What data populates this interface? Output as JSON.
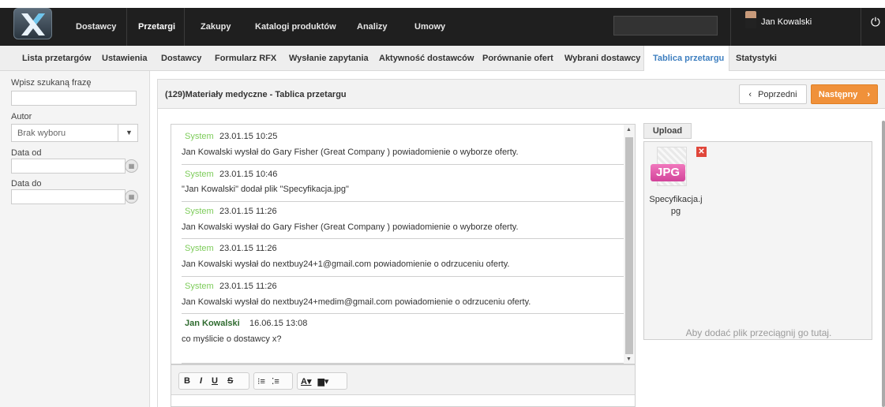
{
  "top_nav": {
    "items": [
      {
        "label": "Dostawcy"
      },
      {
        "label": "Przetargi"
      },
      {
        "label": "Zakupy"
      },
      {
        "label": "Katalogi produktów"
      },
      {
        "label": "Analizy"
      },
      {
        "label": "Umowy"
      }
    ],
    "active": "Przetargi",
    "user_name": "Jan Kowalski",
    "power_icon": "power-icon"
  },
  "sub_nav": {
    "items": [
      {
        "label": "Lista przetargów"
      },
      {
        "label": "Ustawienia"
      },
      {
        "label": "Dostawcy"
      },
      {
        "label": "Formularz RFX"
      },
      {
        "label": "Wysłanie zapytania"
      },
      {
        "label": "Aktywność dostawców"
      },
      {
        "label": "Porównanie ofert"
      },
      {
        "label": "Wybrani dostawcy"
      },
      {
        "label": "Tablica przetargu"
      },
      {
        "label": "Statystyki"
      }
    ],
    "active": "Tablica przetargu"
  },
  "filters": {
    "search_label": "Wpisz szukaną frazę",
    "search_value": "",
    "author_label": "Autor",
    "author_value": "Brak wyboru",
    "date_from_label": "Data od",
    "date_from_value": "",
    "date_to_label": "Data do",
    "date_to_value": ""
  },
  "header": {
    "title": "(129)Materiały medyczne - Tablica przetargu",
    "prev_label": "Poprzedni",
    "next_label": "Następny"
  },
  "messages": [
    {
      "author": "System",
      "type": "system",
      "time": "23.01.15 10:25",
      "text": "Jan Kowalski wysłał do Gary Fisher (Great Company ) powiadomienie o wyborze oferty."
    },
    {
      "author": "System",
      "type": "system",
      "time": "23.01.15 10:46",
      "text": "\"Jan Kowalski\" dodał plik \"Specyfikacja.jpg\""
    },
    {
      "author": "System",
      "type": "system",
      "time": "23.01.15 11:26",
      "text": "Jan Kowalski wysłał do Gary Fisher (Great Company ) powiadomienie o wyborze oferty."
    },
    {
      "author": "System",
      "type": "system",
      "time": "23.01.15 11:26",
      "text": "Jan Kowalski wysłał do nextbuy24+1@gmail.com powiadomienie o odrzuceniu oferty."
    },
    {
      "author": "System",
      "type": "system",
      "time": "23.01.15 11:26",
      "text": "Jan Kowalski wysłał do nextbuy24+medim@gmail.com powiadomienie o odrzuceniu oferty."
    },
    {
      "author": "Jan Kowalski",
      "type": "user",
      "time": "16.06.15 13:08",
      "text": "co myślicie o dostawcy x?"
    }
  ],
  "editor": {
    "buttons": [
      {
        "label": "B"
      },
      {
        "label": "I"
      },
      {
        "label": "U"
      },
      {
        "label": "S"
      },
      {
        "label": "⁝≡"
      },
      {
        "label": "⁚≡"
      },
      {
        "label": "A▾"
      },
      {
        "label": "▆▾"
      }
    ]
  },
  "upload": {
    "button_label": "Upload",
    "file_type": "JPG",
    "file_name": "Specyfikacja.jpg",
    "drop_hint": "Aby dodać plik przeciągnij go tutaj."
  },
  "colors": {
    "accent_blue": "#3e7fc0",
    "next_button": "#f0913a",
    "system_author": "#7dcc5a",
    "user_author": "#2f6b2f",
    "jpg_badge": "#e25aa8"
  }
}
